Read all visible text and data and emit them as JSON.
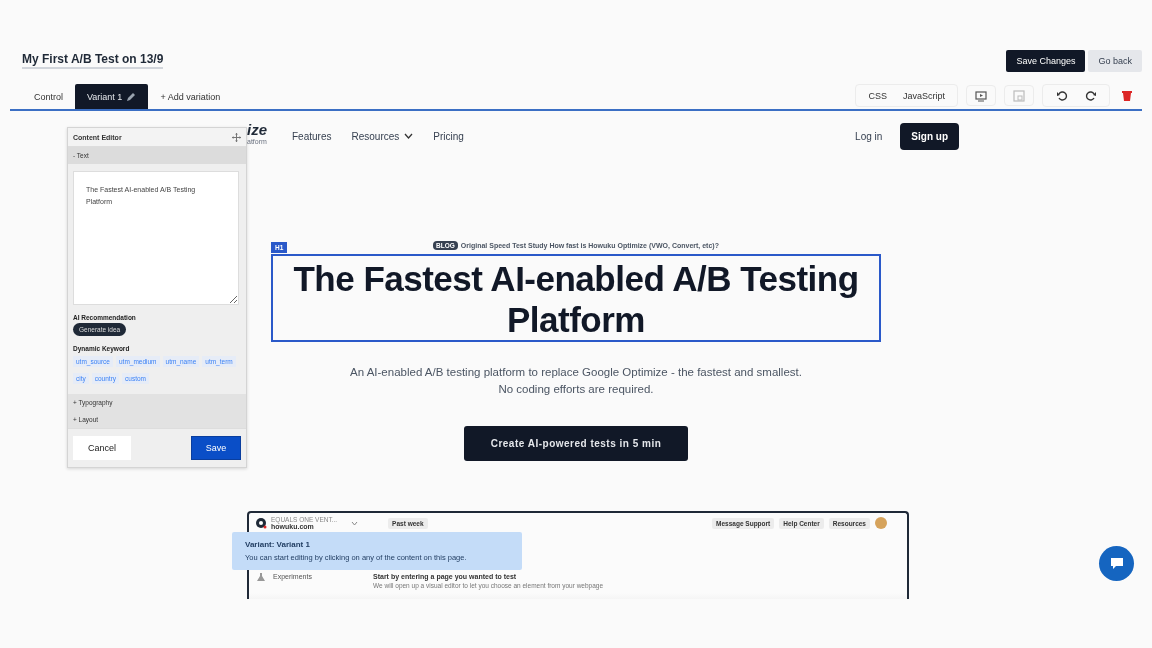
{
  "test_title": "My First A/B Test on 13/9",
  "header_buttons": [
    {
      "label": "Save Changes",
      "kind": "primary"
    },
    {
      "label": "Go back",
      "kind": "secondary"
    }
  ],
  "tabs": [
    {
      "label": "Control",
      "selected": false,
      "editable": false
    },
    {
      "label": "Variant 1",
      "selected": true,
      "editable": true
    },
    {
      "label": "+ Add variation",
      "selected": false,
      "editable": false
    }
  ],
  "code_buttons": [
    "CSS",
    "JavaScript"
  ],
  "site": {
    "logo": "ize",
    "logo_sub": "atform",
    "nav": [
      {
        "label": "Features",
        "dropdown": false
      },
      {
        "label": "Resources",
        "dropdown": true
      },
      {
        "label": "Pricing",
        "dropdown": false
      }
    ],
    "login": "Log in",
    "signup": "Sign up",
    "blog_tag": "BLOG",
    "blog_link": "Original Speed Test Study How fast is Howuku Optimize (VWO, Convert, etc)?",
    "selected_tag": "H1",
    "headline": "The Fastest AI-enabled A/B Testing Platform",
    "subtitle": "An AI-enabled A/B testing platform to replace Google Optimize - the fastest and smallest. No coding efforts are required.",
    "cta": "Create AI-powered tests in 5 min"
  },
  "app_preview": {
    "org": "EQUALS ONE VENT...",
    "site": "howuku.com",
    "range": "Past week",
    "actions": [
      "Message Support",
      "Help Center",
      "Resources"
    ],
    "nav_item": "Experiments",
    "prompt": "Start by entering a page you wanted to test",
    "hint": "We will open up a visual editor to let you choose an element from your webpage"
  },
  "toast": {
    "title": "Variant: Variant 1",
    "message": "You can start editing by clicking on any of the content on this page."
  },
  "editor": {
    "title": "Content Editor",
    "text_section": "- Text",
    "collapsed_sections": [
      "+ Typography",
      "+ Layout"
    ],
    "text_value": "The Fastest AI-enabled A/B Testing Platform",
    "ai_label": "AI Recommendation",
    "generate": "Generate idea",
    "keyword_label": "Dynamic Keyword",
    "keywords": [
      "utm_source",
      "utm_medium",
      "utm_name",
      "utm_term",
      "city",
      "country",
      "custom"
    ],
    "cancel": "Cancel",
    "save": "Save"
  }
}
